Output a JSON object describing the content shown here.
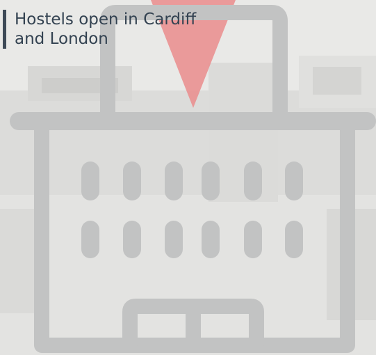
{
  "caption": {
    "line1": "Hostels open in Cardiff",
    "line2": "and London"
  },
  "icons": {
    "building": "building-icon",
    "triangle": "ymca-triangle-icon"
  },
  "colors": {
    "background": "#e9e9e7",
    "building_outline": "#c2c3c3",
    "triangle": "#ea8c8c",
    "caption_text": "#334251",
    "caption_bar": "#3e4a57"
  }
}
